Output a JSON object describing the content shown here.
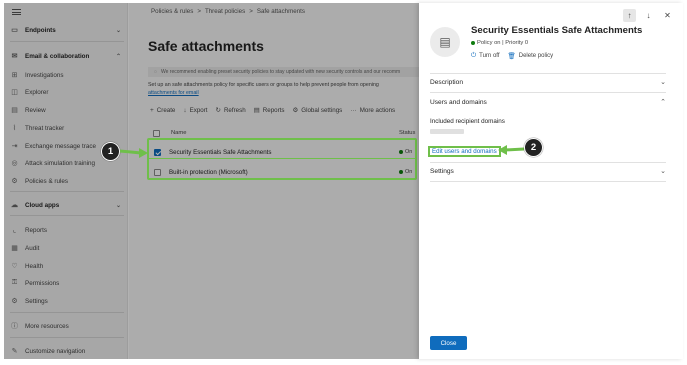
{
  "sidebar": {
    "items": [
      {
        "label": "Endpoints",
        "icon": "endpoints-icon",
        "glyph": "▭",
        "chevron": "⌄"
      },
      {
        "label": "Email & collaboration",
        "icon": "email-icon",
        "glyph": "✉",
        "chevron": "⌃"
      },
      {
        "label": "Investigations",
        "icon": "investigations-icon",
        "glyph": "⊞"
      },
      {
        "label": "Explorer",
        "icon": "explorer-icon",
        "glyph": "◫"
      },
      {
        "label": "Review",
        "icon": "review-icon",
        "glyph": "▤"
      },
      {
        "label": "Threat tracker",
        "icon": "threat-tracker-icon",
        "glyph": "⌇"
      },
      {
        "label": "Exchange message trace",
        "icon": "message-trace-icon",
        "glyph": "⇥"
      },
      {
        "label": "Attack simulation training",
        "icon": "attack-sim-icon",
        "glyph": "◎"
      },
      {
        "label": "Policies & rules",
        "icon": "policies-icon",
        "glyph": "⚙"
      },
      {
        "label": "Cloud apps",
        "icon": "cloud-icon",
        "glyph": "☁",
        "chevron": "⌄"
      },
      {
        "label": "Reports",
        "icon": "reports-icon",
        "glyph": "⌞"
      },
      {
        "label": "Audit",
        "icon": "audit-icon",
        "glyph": "▦"
      },
      {
        "label": "Health",
        "icon": "health-icon",
        "glyph": "♡"
      },
      {
        "label": "Permissions",
        "icon": "permissions-icon",
        "glyph": "⚿"
      },
      {
        "label": "Settings",
        "icon": "settings-icon",
        "glyph": "⚙"
      },
      {
        "label": "More resources",
        "icon": "info-icon",
        "glyph": "ⓘ"
      },
      {
        "label": "Customize navigation",
        "icon": "pencil-icon",
        "glyph": "✎"
      }
    ]
  },
  "main": {
    "breadcrumb": [
      "Policies & rules",
      "Threat policies",
      "Safe attachments"
    ],
    "title": "Safe attachments",
    "banner": "We recommend enabling preset security policies to stay updated with new security controls and our recomm",
    "description": "Set up an safe attachments policy for specific users or groups to help prevent people from opening",
    "description_link": "attachments for email",
    "toolbar": [
      {
        "label": "Create",
        "glyph": "+"
      },
      {
        "label": "Export",
        "glyph": "↓"
      },
      {
        "label": "Refresh",
        "glyph": "↻"
      },
      {
        "label": "Reports",
        "glyph": "▤"
      },
      {
        "label": "Global settings",
        "glyph": "⚙"
      },
      {
        "label": "More actions",
        "glyph": "···"
      }
    ],
    "table": {
      "headers": {
        "name": "Name",
        "status": "Status"
      },
      "rows": [
        {
          "name": "Security Essentials Safe Attachments",
          "status": "On",
          "checked": true
        },
        {
          "name": "Built-in protection (Microsoft)",
          "status": "On",
          "checked": false
        }
      ]
    }
  },
  "callouts": [
    "1",
    "2"
  ],
  "panel": {
    "title": "Security Essentials Safe Attachments",
    "status": "Policy on | Priority 0",
    "actions": [
      {
        "label": "Turn off",
        "glyph": "⏻"
      },
      {
        "label": "Delete policy",
        "glyph": "🗑"
      }
    ],
    "sections": {
      "description": "Description",
      "users_domains": "Users and domains",
      "included_domains": "Included recipient domains",
      "edit_link": "Edit users and domains",
      "settings": "Settings"
    },
    "close_button": "Close"
  },
  "colors": {
    "accent": "#0f6cbd",
    "highlight": "#6fbf4a",
    "status_on": "#107c10"
  }
}
